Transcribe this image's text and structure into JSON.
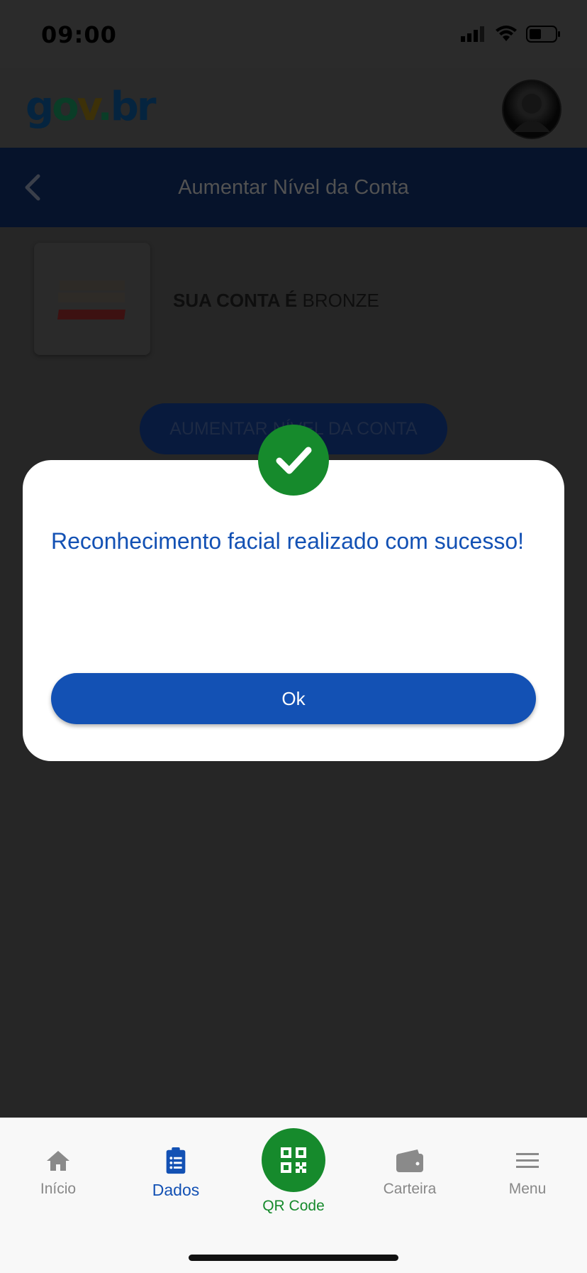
{
  "status_bar": {
    "time": "09:00"
  },
  "header": {
    "logo": {
      "g": "g",
      "o": "o",
      "v": "v",
      "dot": ".",
      "b": "b",
      "r": "r"
    },
    "avatar_icon": "user-avatar"
  },
  "title_bar": {
    "title": "Aumentar Nível da Conta",
    "back_icon": "chevron-left-icon"
  },
  "account": {
    "prefix": "SUA CONTA É",
    "level": "BRONZE"
  },
  "raise_button": {
    "label": "AUMENTAR NÍVEL DA CONTA"
  },
  "modal": {
    "icon": "check-icon",
    "message": "Reconhecimento facial realizado com sucesso!",
    "ok_label": "Ok"
  },
  "bottom_nav": {
    "items": [
      {
        "label": "Início",
        "icon": "home-icon"
      },
      {
        "label": "Dados",
        "icon": "clipboard-list-icon"
      },
      {
        "label": "QR Code",
        "icon": "qr-code-icon"
      },
      {
        "label": "Carteira",
        "icon": "wallet-icon"
      },
      {
        "label": "Menu",
        "icon": "hamburger-icon"
      }
    ]
  },
  "colors": {
    "primary_blue": "#1351b4",
    "success_green": "#168a2c",
    "title_bar_bg": "#06132b",
    "overlay_bg": "#262626"
  }
}
